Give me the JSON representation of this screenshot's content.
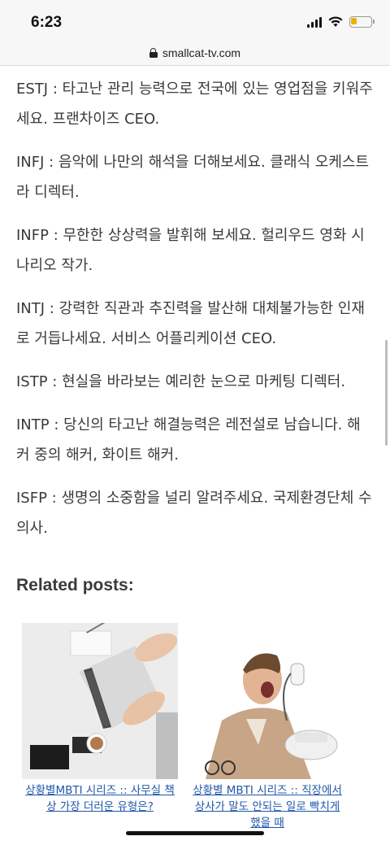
{
  "status": {
    "time": "6:23"
  },
  "browser": {
    "url": "smallcat-tv.com"
  },
  "paragraphs": [
    "ESTJ : 타고난 관리 능력으로 전국에 있는 영업점을 키워주세요. 프랜차이즈 CEO.",
    "INFJ : 음악에 나만의 해석을 더해보세요. 클래식 오케스트라 디렉터.",
    "INFP : 무한한 상상력을 발휘해 보세요. 헐리우드 영화 시나리오 작가.",
    "INTJ : 강력한 직관과 추진력을 발산해 대체불가능한 인재로 거듭나세요. 서비스 어플리케이션 CEO.",
    "ISTP : 현실을 바라보는 예리한 눈으로 마케팅 디렉터.",
    "INTP : 당신의 타고난 해결능력은 레전설로 남습니다. 해커 중의 해커, 화이트 해커.",
    "ISFP : 생명의 소중함을 널리 알려주세요. 국제환경단체 수의사."
  ],
  "related": {
    "heading": "Related posts:",
    "posts": [
      {
        "title": "상황별MBTI 시리즈 :: 사무실 책상 가장 더러운 유형은?",
        "image": "laptop-desk-photo"
      },
      {
        "title": "상황별 MBTI 시리즈 :: 직장에서 상사가 말도 안되는 일로 빡치게 했을 때",
        "image": "man-shouting-phone-photo"
      }
    ]
  }
}
